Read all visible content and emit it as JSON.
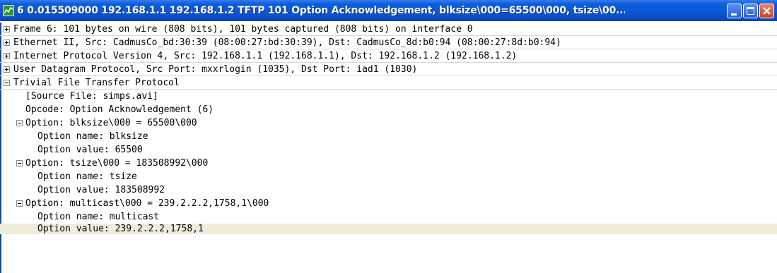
{
  "window": {
    "title": "6 0.015509000 192.168.1.1 192.168.1.2 TFTP 101 Option Acknowledgement, blksize\\000=65500\\000, tsize\\00..."
  },
  "tree": {
    "rows": [
      {
        "text": "Frame 6: 101 bytes on wire (808 bits), 101 bytes captured (808 bits) on interface 0"
      },
      {
        "text": "Ethernet II, Src: CadmusCo_bd:30:39 (08:00:27:bd:30:39), Dst: CadmusCo_8d:b0:94 (08:00:27:8d:b0:94)"
      },
      {
        "text": "Internet Protocol Version 4, Src: 192.168.1.1 (192.168.1.1), Dst: 192.168.1.2 (192.168.1.2)"
      },
      {
        "text": "User Datagram Protocol, Src Port: mxxrlogin (1035), Dst Port: iad1 (1030)"
      },
      {
        "text": "Trivial File Transfer Protocol"
      },
      {
        "text": "[Source File: simps.avi]"
      },
      {
        "text": "Opcode: Option Acknowledgement (6)"
      },
      {
        "text": "Option: blksize\\000 = 65500\\000"
      },
      {
        "text": "Option name: blksize"
      },
      {
        "text": "Option value: 65500"
      },
      {
        "text": "Option: tsize\\000 = 183508992\\000"
      },
      {
        "text": "Option name: tsize"
      },
      {
        "text": "Option value: 183508992"
      },
      {
        "text": "Option: multicast\\000 = 239.2.2.2,1758,1\\000"
      },
      {
        "text": "Option name: multicast"
      },
      {
        "text": "Option value: 239.2.2.2,1758,1"
      }
    ]
  }
}
